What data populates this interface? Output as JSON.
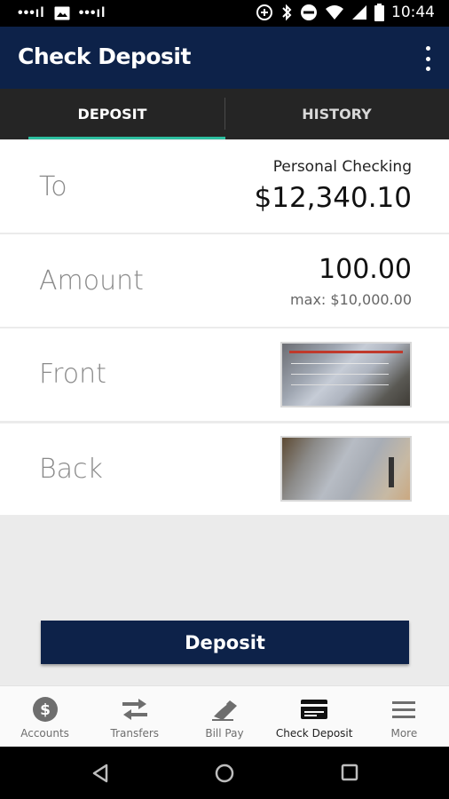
{
  "status_bar": {
    "time": "10:44",
    "left_icons": [
      "signal-dots-icon",
      "image-icon",
      "signal-dots-icon"
    ],
    "right_icons": [
      "data-saver-icon",
      "bluetooth-icon",
      "do-not-disturb-icon",
      "wifi-icon",
      "cell-signal-icon",
      "battery-icon"
    ]
  },
  "app_bar": {
    "title": "Check Deposit",
    "overflow_icon": "more-vert-icon"
  },
  "tabs": [
    {
      "label": "DEPOSIT",
      "active": true
    },
    {
      "label": "HISTORY",
      "active": false
    }
  ],
  "accent_color": "#2dbfa0",
  "brand_color": "#0d2249",
  "form": {
    "to": {
      "label": "To",
      "account_name": "Personal Checking",
      "balance": "$12,340.10"
    },
    "amount": {
      "label": "Amount",
      "value": "100.00",
      "max": "max: $10,000.00"
    },
    "front": {
      "label": "Front"
    },
    "back": {
      "label": "Back"
    }
  },
  "deposit_button": {
    "label": "Deposit"
  },
  "bottom_nav": [
    {
      "label": "Accounts",
      "icon": "dollar-circle-icon",
      "active": false
    },
    {
      "label": "Transfers",
      "icon": "transfer-arrows-icon",
      "active": false
    },
    {
      "label": "Bill Pay",
      "icon": "bill-pay-icon",
      "active": false
    },
    {
      "label": "Check Deposit",
      "icon": "check-deposit-icon",
      "active": true
    },
    {
      "label": "More",
      "icon": "menu-icon",
      "active": false
    }
  ],
  "android_nav": [
    "back-icon",
    "home-icon",
    "recents-icon"
  ]
}
